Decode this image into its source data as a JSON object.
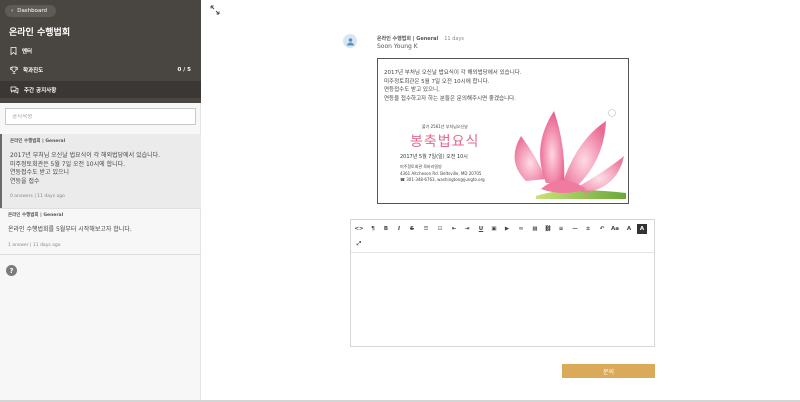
{
  "sidebar": {
    "dashboard_label": "Dashboard",
    "title": "온라인 수행법회",
    "nav": [
      {
        "label": "멘터",
        "icon": "bookmark-icon"
      },
      {
        "label": "학과진도",
        "icon": "trophy-icon",
        "count": "0 / 5"
      },
      {
        "label": "주간 공지사항",
        "icon": "chat-icon"
      }
    ],
    "compose_placeholder": "공지작성",
    "posts": [
      {
        "meta": "온라인 수행법회 | General",
        "lines": [
          "2017년 부처님 오신날 법요식이 각 해외법당에서 있습니다.",
          "미주정토회관은 5월 7일 오전 10시에 합니다.",
          "연등접수도 받고 있으니",
          "연등을 접수"
        ],
        "foot": "0 answers | 11 days ago"
      },
      {
        "meta": "온라인 수행법회 | General",
        "lines": [
          "온라인 수행법회를 5월부터 시작해보고자 합니다."
        ],
        "foot": "1 answer | 11 days ago"
      }
    ],
    "help_label": "?"
  },
  "main": {
    "post_group": "온라인 수행법회 | General",
    "post_time": "11 days",
    "author": "Soon Young K",
    "content_lines": [
      "2017년 부처님 오신날 법요식이 각 해외법당에서 있습니다.",
      "미주정토회관은 5월 7일 오전 10시에 합니다.",
      "연등접수도 받고 있으니,",
      "연등을 접수하고자 하는 분들은 문의해주시면 좋겠습니다."
    ],
    "poster": {
      "subtitle": "불기 2561년 부처님오신날",
      "title": "봉축법요식",
      "date": "2017년 5월 7일(일) 오전 10시",
      "venue": "미주정토회관 육바라밀방",
      "address": "4361 Aitcheson Rd. Beltsville, MD 20705",
      "phone": "☎ 301-348-6763, washington@jungto.org"
    },
    "submit_label": "문의"
  },
  "colors": {
    "sidebar_dark": "#494541",
    "submit": "#dba95a",
    "accent_pink": "#e06a8a"
  }
}
